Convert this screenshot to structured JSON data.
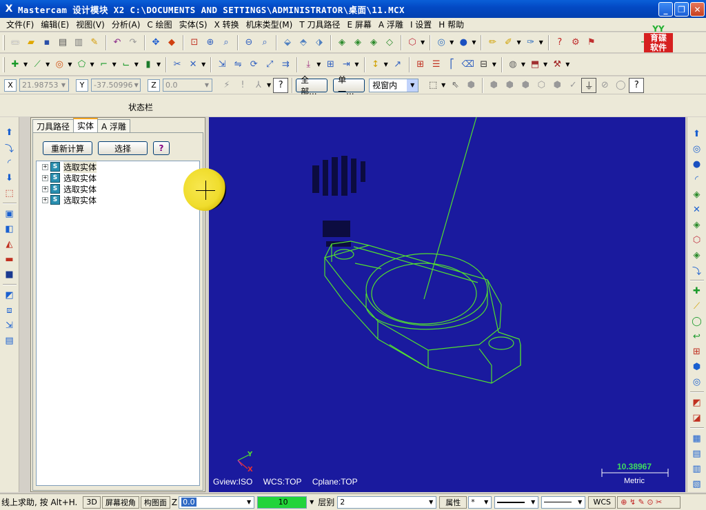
{
  "window": {
    "title": "Mastercam 设计模块  X2  C:\\DOCUMENTS AND SETTINGS\\ADMINISTRATOR\\桌面\\11.MCX",
    "app_glyph": "X",
    "min_glyph": "_",
    "max_glyph": "❐",
    "close_glyph": "✕"
  },
  "menu": [
    "文件(F)",
    "编辑(E)",
    "视图(V)",
    "分析(A)",
    "C 绘图",
    "实体(S)",
    "X 转换",
    "机床类型(M)",
    "T 刀具路径",
    "E 屏幕",
    "A 浮雕",
    "I 设置",
    "H 帮助"
  ],
  "logo": {
    "top": "YY",
    "bottom1": "育碟",
    "bottom2": "软件"
  },
  "coords": {
    "x_label": "X",
    "x_value": "21.98753",
    "y_label": "Y",
    "y_value": "-37.50996",
    "z_label": "Z",
    "z_value": "0.0",
    "all_button": "全部...",
    "single_button": "单一...",
    "window_mode": "视窗内"
  },
  "status_caption": "状态栏",
  "panel": {
    "tabs": [
      "刀具路径",
      "实体",
      "A 浮雕"
    ],
    "active_tab": 1,
    "recalc_button": "重新计算",
    "select_button": "选择",
    "help_button": "?",
    "tree_items": [
      "选取实体",
      "选取实体",
      "选取实体",
      "选取实体"
    ]
  },
  "viewport": {
    "gview": "Gview:ISO",
    "wcs": "WCS:TOP",
    "cplane": "Cplane:TOP",
    "axis_y": "Y",
    "axis_x": "X",
    "scale_value": "10.38967",
    "scale_unit": "Metric"
  },
  "bottom": {
    "prompt": "线上求助, 按 Alt+H.",
    "btn_3d": "3D",
    "btn_screen_view": "屏幕视角",
    "btn_construction": "构图面",
    "z_label": "Z",
    "z_value": "0.0",
    "color_value": "10",
    "level_label": "层别",
    "level_value": "2",
    "attr_label": "属性",
    "wcs_label": "WCS",
    "point_style": "*"
  },
  "colors": {
    "viewport_bg": "#1a1a9e",
    "wireframe": "#52e02f",
    "title_bg": "#0349c4",
    "color_swatch": "#22d43a"
  }
}
